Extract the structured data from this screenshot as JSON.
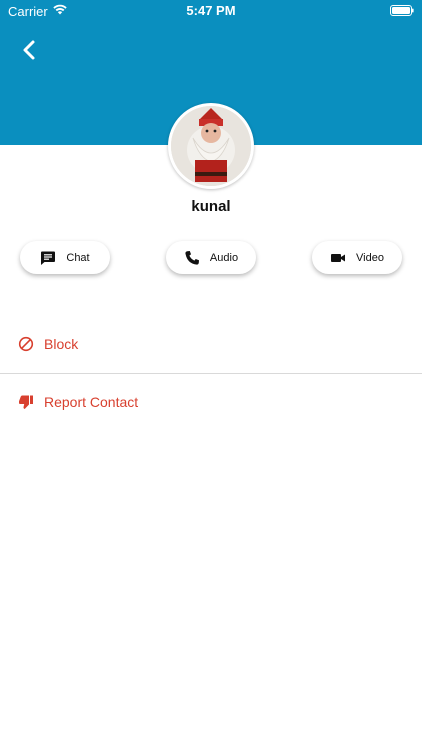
{
  "status_bar": {
    "carrier": "Carrier",
    "time": "5:47 PM"
  },
  "header": {
    "color": "#0a8fbf"
  },
  "profile": {
    "name": "kunal"
  },
  "actions": {
    "chat_label": "Chat",
    "audio_label": "Audio",
    "video_label": "Video"
  },
  "menu": {
    "block_label": "Block",
    "report_label": "Report Contact",
    "danger_color": "#d8402f"
  },
  "icons": {
    "back": "chevron-left",
    "chat": "chat-bubble",
    "audio": "phone",
    "video": "video-camera",
    "block": "block-circle",
    "report": "thumbs-down"
  }
}
